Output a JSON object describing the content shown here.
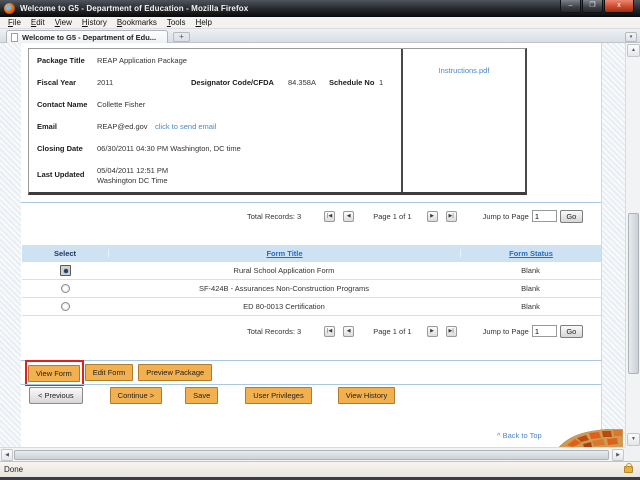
{
  "window": {
    "title": "Welcome to G5 - Department of Education - Mozilla Firefox",
    "controls": {
      "minimize": "–",
      "maximize": "❐",
      "close": "x"
    }
  },
  "menu": {
    "items": [
      "File",
      "Edit",
      "View",
      "History",
      "Bookmarks",
      "Tools",
      "Help"
    ]
  },
  "tabs": {
    "active_label": "Welcome to G5 - Department of Edu...",
    "new_tab": "+",
    "list_all": "▾"
  },
  "package": {
    "package_title_label": "Package Title",
    "package_title": "REAP Application Package",
    "fiscal_year_label": "Fiscal Year",
    "fiscal_year": "2011",
    "designator_label": "Designator Code/CFDA",
    "designator": "84.358A",
    "schedule_label": "Schedule No",
    "schedule": "1",
    "contact_label": "Contact Name",
    "contact": "Collette Fisher",
    "email_label": "Email",
    "email": "REAP@ed.gov",
    "email_link": "click to send email",
    "closing_label": "Closing Date",
    "closing": "06/30/2011 04:30 PM Washington, DC time",
    "updated_label": "Last Updated",
    "updated_line1": "05/04/2011 12:51 PM",
    "updated_line2": "Washington DC Time",
    "instructions_link": "Instructions.pdf"
  },
  "pagination": {
    "total_label": "Total Records: 3",
    "page_label": "Page 1 of 1",
    "jump_label": "Jump to Page",
    "jump_value": "1",
    "go_label": "Go",
    "first_icon": "|◀",
    "prev_icon": "◀",
    "next_icon": "▶",
    "last_icon": "▶|"
  },
  "table": {
    "headers": {
      "select": "Select",
      "title": "Form Title",
      "status": "Form Status"
    },
    "rows": [
      {
        "title": "Rural School Application Form",
        "status": "Blank",
        "selected": true
      },
      {
        "title": "SF-424B - Assurances Non-Construction Programs",
        "status": "Blank",
        "selected": false
      },
      {
        "title": "ED 80-0013 Certification",
        "status": "Blank",
        "selected": false
      }
    ]
  },
  "buttons": {
    "view_form": "View Form",
    "edit_form": "Edit Form",
    "preview_package": "Preview Package",
    "previous": "< Previous",
    "continue": "Continue >",
    "save": "Save",
    "user_privileges": "User Privileges",
    "view_history": "View History"
  },
  "footer": {
    "back_to_top": "^ Back to Top"
  },
  "statusbar": {
    "text": "Done"
  },
  "colors": {
    "button_orange": "#f2b04e",
    "link_blue": "#4a86c8",
    "table_header_bg": "#cfe2f3",
    "annotation_red": "#e01f1f",
    "titlebar_dark": "#23262c"
  }
}
